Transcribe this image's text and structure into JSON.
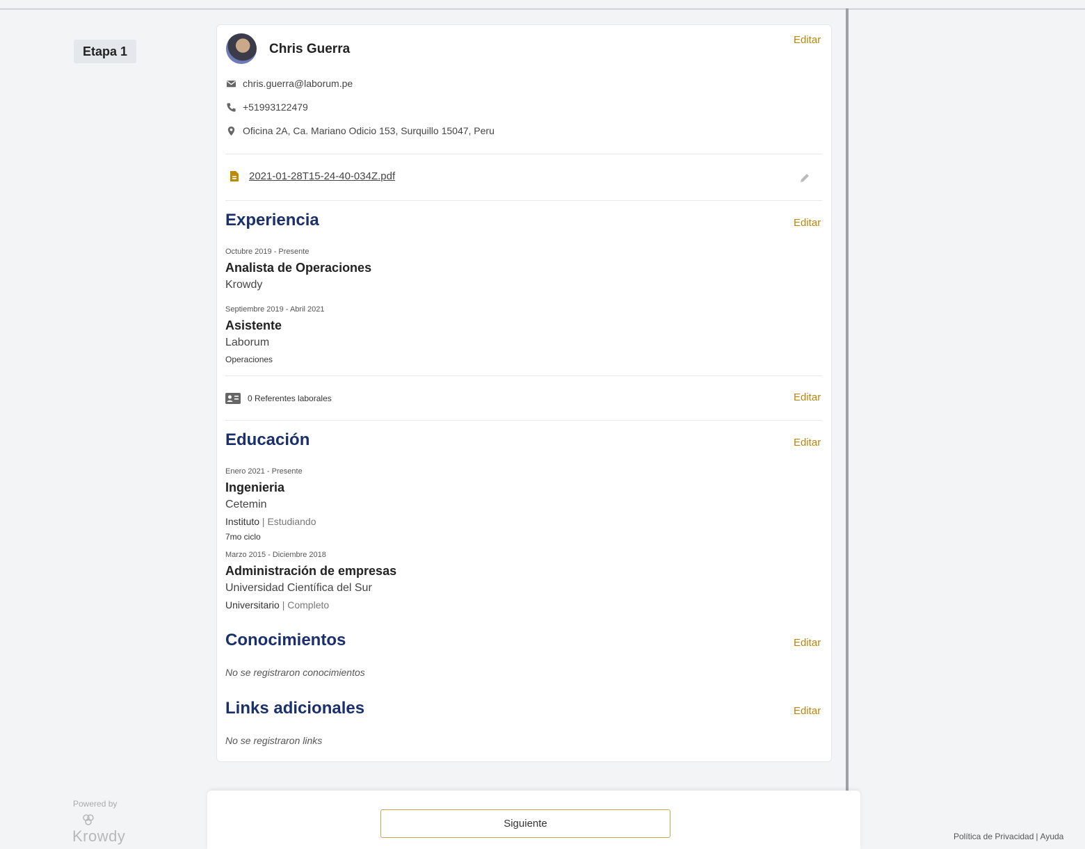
{
  "stage": {
    "label": "Etapa 1"
  },
  "profile": {
    "name": "Chris Guerra",
    "edit_label": "Editar",
    "email": "chris.guerra@laborum.pe",
    "phone": "+51993122479",
    "address": "Oficina 2A, Ca. Mariano Odicio 153, Surquillo 15047, Peru",
    "cv_file": "2021-01-28T15-24-40-034Z.pdf"
  },
  "experience": {
    "title": "Experiencia",
    "edit_label": "Editar",
    "items": [
      {
        "dates": "Octubre 2019 - Presente",
        "role": "Analista de Operaciones",
        "company": "Krowdy"
      },
      {
        "dates": "Septiembre 2019 - Abril 2021",
        "role": "Asistente",
        "company": "Laborum",
        "area": "Operaciones"
      }
    ]
  },
  "references": {
    "label": "0 Referentes laborales",
    "edit_label": "Editar"
  },
  "education": {
    "title": "Educación",
    "edit_label": "Editar",
    "items": [
      {
        "dates": "Enero 2021 - Presente",
        "degree": "Ingenieria",
        "institution": "Cetemin",
        "level": "Instituto",
        "status": "Estudiando",
        "extra": "7mo ciclo"
      },
      {
        "dates": "Marzo 2015 - Diciembre 2018",
        "degree": "Administración de empresas",
        "institution": "Universidad Científica del Sur",
        "level": "Universitario",
        "status": "Completo"
      }
    ]
  },
  "knowledge": {
    "title": "Conocimientos",
    "edit_label": "Editar",
    "empty": "No se registraron conocimientos"
  },
  "links": {
    "title": "Links adicionales",
    "edit_label": "Editar",
    "empty": "No se registraron links"
  },
  "footer": {
    "next_label": "Siguiente",
    "powered_by": "Powered by",
    "brand": "Krowdy",
    "privacy": "Política de Privacidad",
    "separator": "|",
    "help": "Ayuda"
  },
  "colors": {
    "accent": "#b8860b",
    "section_title": "#1a2f6e",
    "background": "#f3f4f6"
  },
  "icons": [
    "mail-icon",
    "phone-icon",
    "location-pin-icon",
    "pdf-file-icon",
    "pencil-icon",
    "contact-card-icon",
    "krowdy-logo-icon"
  ]
}
